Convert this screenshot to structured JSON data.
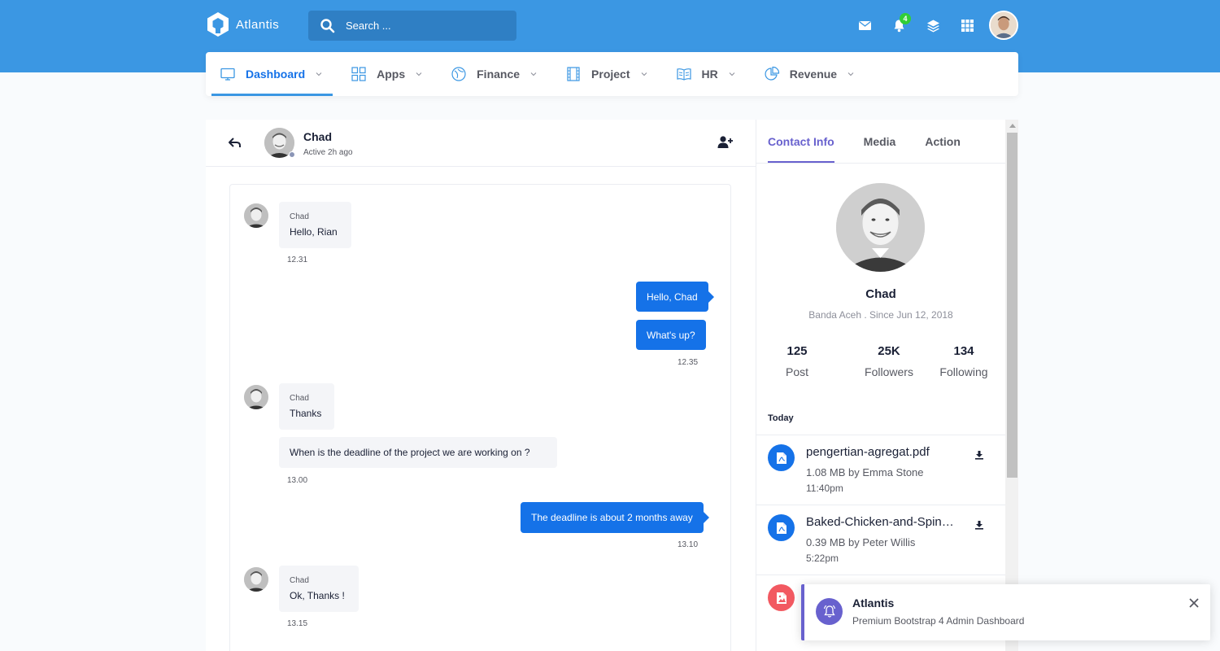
{
  "header": {
    "brand": "Atlantis",
    "search_placeholder": "Search ...",
    "notification_count": "4",
    "icons": [
      "envelope-icon",
      "bell-icon",
      "layers-icon",
      "grid-icon"
    ]
  },
  "nav": {
    "items": [
      {
        "label": "Dashboard",
        "icon": "desktop-icon",
        "active": true
      },
      {
        "label": "Apps",
        "icon": "grid-icon"
      },
      {
        "label": "Finance",
        "icon": "compass-icon"
      },
      {
        "label": "Project",
        "icon": "film-icon"
      },
      {
        "label": "HR",
        "icon": "book-icon"
      },
      {
        "label": "Revenue",
        "icon": "pie-chart-icon"
      }
    ]
  },
  "chat": {
    "name": "Chad",
    "status": "Active 2h ago",
    "messages": [
      {
        "dir": "in",
        "sender": "Chad",
        "text": "Hello, Rian"
      },
      {
        "dir": "in_time",
        "time": "12.31"
      },
      {
        "dir": "out",
        "text": "Hello, Chad"
      },
      {
        "dir": "out",
        "text": "What's up?"
      },
      {
        "dir": "out_time",
        "time": "12.35"
      },
      {
        "dir": "in",
        "sender": "Chad",
        "text": "Thanks"
      },
      {
        "dir": "in",
        "text": "When is the deadline of the project we are working on ?"
      },
      {
        "dir": "in_time",
        "time": "13.00"
      },
      {
        "dir": "out",
        "text": "The deadline is about 2 months away"
      },
      {
        "dir": "out_time",
        "time": "13.10"
      },
      {
        "dir": "in",
        "sender": "Chad",
        "text": "Ok, Thanks !"
      },
      {
        "dir": "in_time",
        "time": "13.15"
      }
    ]
  },
  "info": {
    "tabs": [
      "Contact Info",
      "Media",
      "Action"
    ],
    "active_tab": "Contact Info",
    "profile": {
      "name": "Chad",
      "subtitle": "Banda Aceh . Since Jun 12, 2018"
    },
    "stats": [
      {
        "value": "125",
        "label": "Post"
      },
      {
        "value": "25K",
        "label": "Followers"
      },
      {
        "value": "134",
        "label": "Following"
      }
    ],
    "today_label": "Today",
    "files": [
      {
        "name": "pengertian-agregat.pdf",
        "meta": "1.08 MB by Emma Stone",
        "time": "11:40pm",
        "color": "#1572e8",
        "icon": "file-pdf-icon"
      },
      {
        "name": "Baked-Chicken-and-Spinach.pdf",
        "meta": "0.39 MB by Peter Willis",
        "time": "5:22pm",
        "color": "#1572e8",
        "icon": "file-pdf-icon"
      },
      {
        "name": "",
        "meta": "",
        "time": "",
        "color": "#f25961",
        "icon": "file-image-icon"
      }
    ]
  },
  "toast": {
    "title": "Atlantis",
    "message": "Premium Bootstrap 4 Admin Dashboard",
    "icon": "bell-icon"
  },
  "colors": {
    "header_bg": "#3b97e3",
    "primary": "#1572e8",
    "secondary": "#6861ce",
    "danger": "#f25961",
    "badge": "#31ce36"
  }
}
